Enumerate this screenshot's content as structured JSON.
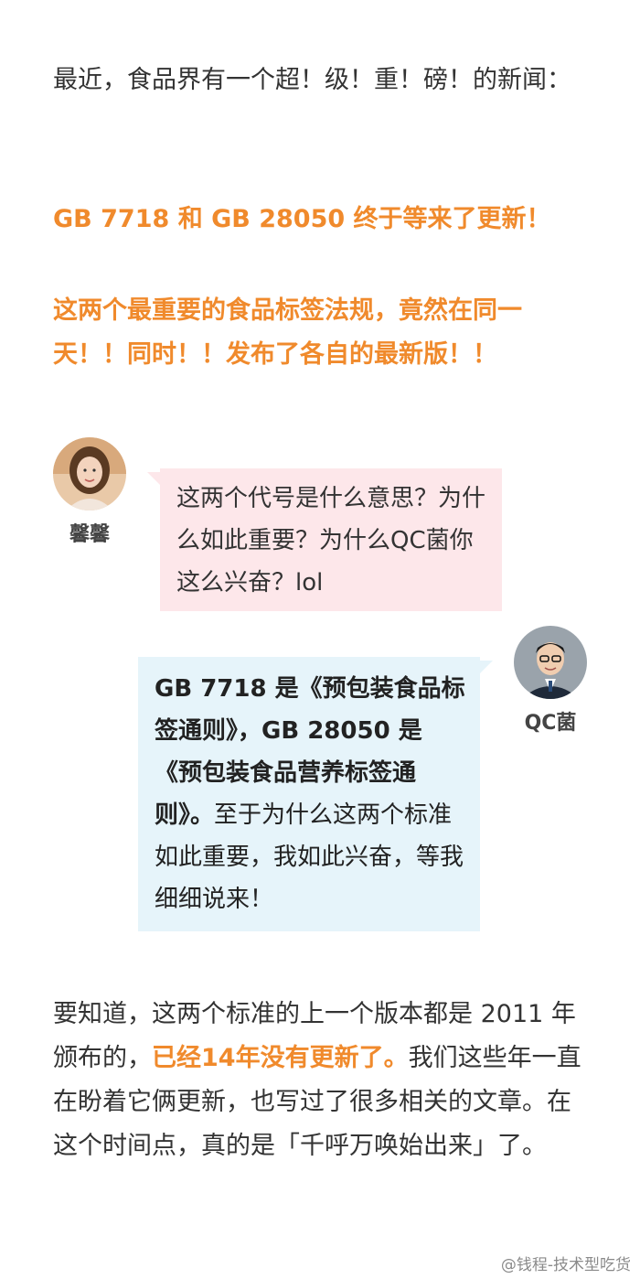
{
  "intro": "最近，食品界有一个超！级！重！磅！的新闻：",
  "headline_1": "GB 7718 和 GB 28050 终于等来了更新！",
  "headline_2": "这两个最重要的食品标签法规，竟然在同一天！！同时！！发布了各自的最新版！！",
  "dialog": {
    "xinxin": {
      "name": "馨馨",
      "text": "这两个代号是什么意思？为什么如此重要？为什么QC菌你这么兴奋？lol"
    },
    "qc": {
      "name": "QC菌",
      "text_bold": "GB 7718 是《预包装食品标签通则》，GB 28050 是《预包装食品营养标签通则》。",
      "text_rest": "至于为什么这两个标准如此重要，我如此兴奋，等我细细说来！"
    }
  },
  "body": {
    "part1": "要知道，这两个标准的上一个版本都是 2011 年颁布的，",
    "highlight": "已经14年没有更新了。",
    "part2": "我们这些年一直在盼着它俩更新，也写过了很多相关的文章。在这个时间点，真的是「千呼万唤始出来」了。"
  },
  "watermark": "@钱程-技术型吃货",
  "colors": {
    "accent": "#f08a2c",
    "pink_bubble": "#fde7ea",
    "blue_bubble": "#e6f4fa"
  }
}
